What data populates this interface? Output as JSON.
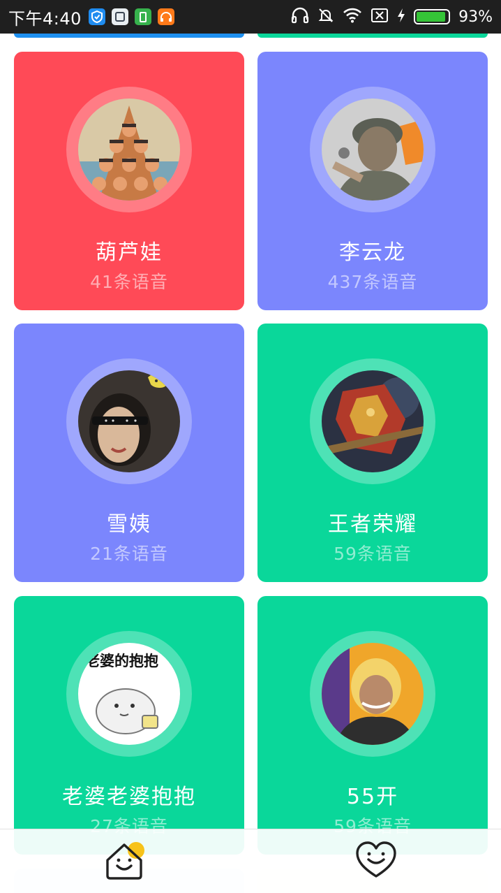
{
  "status_bar": {
    "time": "下午4:40",
    "battery_percent": "93%",
    "battery_level": 0.93
  },
  "colors": {
    "red": "#ff4a57",
    "blue": "#7b86fd",
    "green": "#0ad79a"
  },
  "voice_packs": [
    {
      "name": "葫芦娃",
      "count": "41条语音",
      "color": "red"
    },
    {
      "name": "李云龙",
      "count": "437条语音",
      "color": "blue"
    },
    {
      "name": "雪姨",
      "count": "21条语音",
      "color": "blue"
    },
    {
      "name": "王者荣耀",
      "count": "59条语音",
      "color": "green"
    },
    {
      "name": "老婆老婆抱抱",
      "count": "27条语音",
      "color": "green",
      "avatar_caption": "老婆的抱抱"
    },
    {
      "name": "55开",
      "count": "59条语音",
      "color": "green"
    }
  ],
  "bottom_nav": {
    "tabs": [
      {
        "icon": "home-smile-icon",
        "active": true
      },
      {
        "icon": "heart-smile-icon",
        "active": false
      }
    ]
  }
}
